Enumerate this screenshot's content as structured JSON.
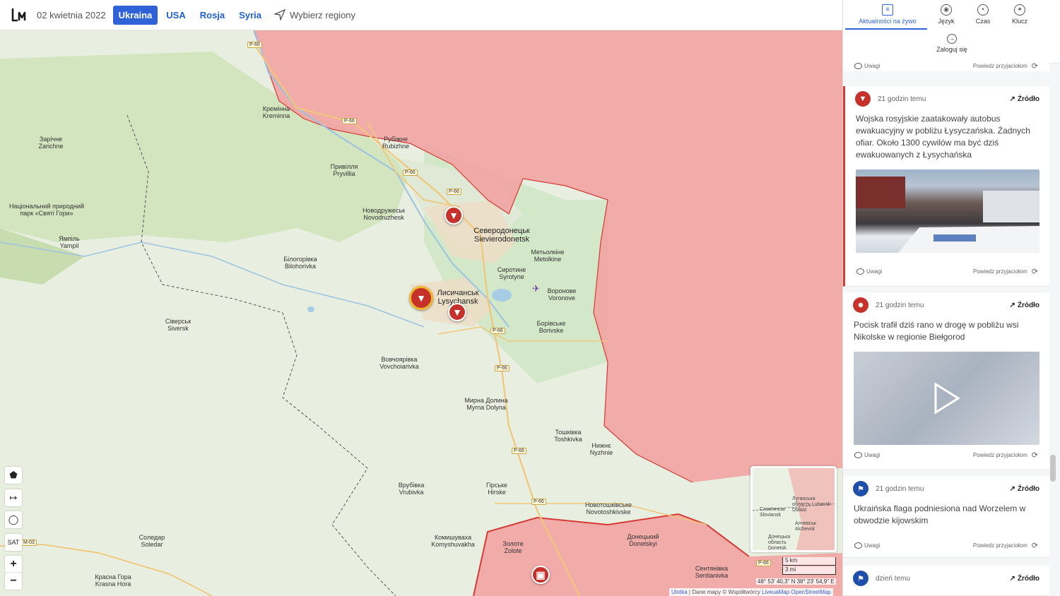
{
  "topbar": {
    "date": "02 kwietnia 2022",
    "regions": [
      "Ukraina",
      "USA",
      "Rosja",
      "Syria"
    ],
    "active_region": "Ukraina",
    "choose_regions": "Wybierz regiony"
  },
  "map": {
    "places": [
      {
        "id": "kreminna",
        "l1": "Кремінна",
        "l2": "Kreminna"
      },
      {
        "id": "zarichne",
        "l1": "Зарічне",
        "l2": "Zarichne"
      },
      {
        "id": "rubizhne",
        "l1": "Рубіжне",
        "l2": "Rubizhne"
      },
      {
        "id": "pryvillia",
        "l1": "Привілля",
        "l2": "Pryvillia"
      },
      {
        "id": "park",
        "l1": "Національний природний парк «Святі Гори»",
        "l2": ""
      },
      {
        "id": "yampil",
        "l1": "Ямпіль",
        "l2": "Yampil"
      },
      {
        "id": "novodruzhesk",
        "l1": "Новодружеськ",
        "l2": "Novodruzhesk"
      },
      {
        "id": "sievierodonetsk",
        "l1": "Северодонецьк",
        "l2": "Sievierodonetsk"
      },
      {
        "id": "metolkine",
        "l1": "Метьолкіне",
        "l2": "Metolkine"
      },
      {
        "id": "bilohorivka",
        "l1": "Білогорівка",
        "l2": "Bilohorivka"
      },
      {
        "id": "syrotyne",
        "l1": "Сиротине",
        "l2": "Syrotyne"
      },
      {
        "id": "lysychansk",
        "l1": "Лисичанськ",
        "l2": "Lysychansk"
      },
      {
        "id": "voronove",
        "l1": "Воронове",
        "l2": "Voronove"
      },
      {
        "id": "siversk",
        "l1": "Сіверськ",
        "l2": "Siversk"
      },
      {
        "id": "borivske",
        "l1": "Борівське",
        "l2": "Borivske"
      },
      {
        "id": "vovchoiarivka",
        "l1": "Вовчоярівка",
        "l2": "Vovchoiarivka"
      },
      {
        "id": "myrna",
        "l1": "Мирна Долина",
        "l2": "Myrna Dolyna"
      },
      {
        "id": "toshkivka",
        "l1": "Тошківка",
        "l2": "Toshkivka"
      },
      {
        "id": "nyzhnie",
        "l1": "Нижнє",
        "l2": "Nyzhnie"
      },
      {
        "id": "vrubivka",
        "l1": "Врубівка",
        "l2": "Vrubivka"
      },
      {
        "id": "hirske",
        "l1": "Гірське",
        "l2": "Hirske"
      },
      {
        "id": "novotoshkivske",
        "l1": "Новотошківське",
        "l2": "Novotoshkivske"
      },
      {
        "id": "soledar",
        "l1": "Соледар",
        "l2": "Soledar"
      },
      {
        "id": "komyshuvakha",
        "l1": "Комишуваха",
        "l2": "Komyshuvakha"
      },
      {
        "id": "zolote",
        "l1": "Золоте",
        "l2": "Zolote"
      },
      {
        "id": "donetskyi",
        "l1": "Донецький",
        "l2": "Donetskyi"
      },
      {
        "id": "krasna",
        "l1": "Красна Гора",
        "l2": "Krasna Hora"
      },
      {
        "id": "sentianivka",
        "l1": "Сентянівка",
        "l2": "Sentianivka"
      }
    ],
    "roads": [
      "P-66",
      "P-66",
      "P-66",
      "P-66",
      "P-66",
      "P-66",
      "P-66",
      "P-66",
      "P-66",
      "M-03"
    ],
    "tools": {
      "sat": "SAT",
      "zoom_in": "+",
      "zoom_out": "−"
    },
    "minimap": {
      "labels": [
        "Луганська область Luhansk Oblast",
        "Слов'янськ Sloviansk",
        "Алчевськ Alchevsk",
        "Донецька область Donetsk"
      ]
    },
    "scale": {
      "km": "5 km",
      "mi": "3 mi"
    },
    "coords": "48° 53' 40,3\" N 38° 23' 54,9\" E",
    "attribution": {
      "leaflet": "Ulotka",
      "data": "| Dane mapy © Współtwórcy",
      "links": "LiveuaMap OpenStreetMap"
    }
  },
  "sidebar": {
    "tabs": [
      {
        "label": "Aktualności na żywo",
        "icon": "news-icon"
      },
      {
        "label": "Język",
        "icon": "language-icon"
      },
      {
        "label": "Czas",
        "icon": "clock-icon"
      },
      {
        "label": "Klucz",
        "icon": "compass-icon"
      }
    ],
    "login": "Zaloguj się",
    "comments_label": "Uwagi",
    "share_label": "Powiedz przyjaciołom",
    "source_label": "Źródło",
    "cards": [
      {
        "time": "21 godzin temu",
        "text": "Wojska rosyjskie zaatakowały autobus ewakuacyjny w pobliżu Łysyczańska. Żadnych ofiar. Około 1300 cywilów ma być dziś ewakuowanych z Łysychańska"
      },
      {
        "time": "21 godzin temu",
        "text": "Pocisk trafił dziś rano w drogę w pobliżu wsi Nikolske w regionie Biełgorod"
      },
      {
        "time": "21 godzin temu",
        "text": "Ukraińska flaga podniesiona nad Worzelem w obwodzie kijowskim"
      },
      {
        "time": "dzień temu",
        "text": ""
      }
    ]
  },
  "colors": {
    "accent": "#2f62d6",
    "occupied": "#f2a3a3",
    "marker": "#c4322b"
  }
}
